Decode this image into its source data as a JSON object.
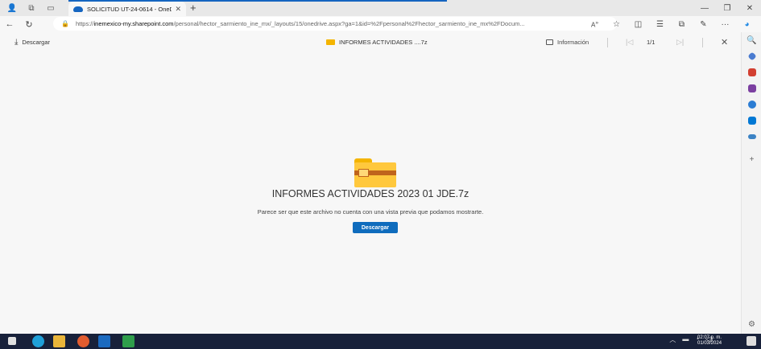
{
  "browser": {
    "tab_title": "SOLICITUD UT-24-0614 - OneDr",
    "url_prefix": "https://",
    "url_host": "inemexico-my.sharepoint.com",
    "url_rest": "/personal/hector_sarmiento_ine_mx/_layouts/15/onedrive.aspx?ga=1&id=%2Fpersonal%2Fhector_sarmiento_ine_mx%2FDocum..."
  },
  "viewer": {
    "download_label": "Descargar",
    "file_name_short": "INFORMES ACTIVIDADES ....7z",
    "info_label": "Información",
    "page_indicator": "1/1"
  },
  "content": {
    "file_title": "INFORMES ACTIVIDADES 2023 01 JDE.7z",
    "message": "Parece ser que este archivo no cuenta con una vista previa que podamos mostrarte.",
    "download_button": "Descargar"
  },
  "taskbar": {
    "time": "02:07 p. m.",
    "date": "01/03/2024"
  },
  "colors": {
    "accent": "#0f6cbd",
    "folder": "#ffc83d",
    "taskbar": "#18213a"
  }
}
